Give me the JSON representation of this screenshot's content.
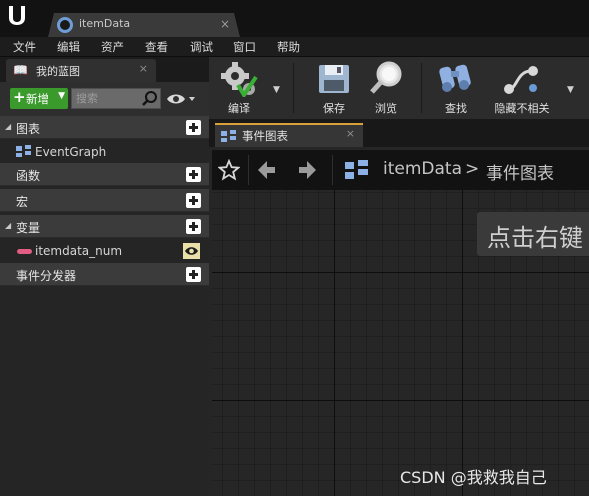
{
  "window": {
    "tab_title": "itemData",
    "tab_close": "×"
  },
  "menu": [
    "文件",
    "编辑",
    "资产",
    "查看",
    "调试",
    "窗口",
    "帮助"
  ],
  "left_panel": {
    "tab_title": "我的蓝图",
    "tab_close": "×",
    "add_button": "新增",
    "search_placeholder": "搜索",
    "sections": {
      "graphs": "图表",
      "graph_item": "EventGraph",
      "functions": "函数",
      "macros": "宏",
      "variables": "变量",
      "variable_item": "itemdata_num",
      "dispatchers": "事件分发器"
    },
    "variable_color": "#e25c83"
  },
  "toolbar": {
    "compile": "编译",
    "save": "保存",
    "browse": "浏览",
    "find": "查找",
    "hide_unrelated": "隐藏不相关"
  },
  "graph": {
    "tab_title": "事件图表",
    "tab_close": "×",
    "breadcrumb_root": "itemData",
    "breadcrumb_sep": ">",
    "breadcrumb_current": "事件图表",
    "hint_text": "点击右键",
    "accent": "#d8a13a"
  },
  "watermark": "CSDN @我救我自己"
}
